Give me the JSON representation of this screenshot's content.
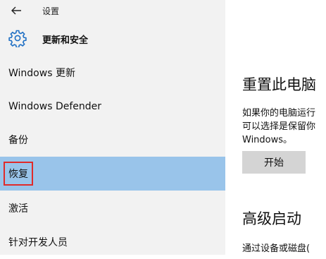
{
  "window": {
    "title": "设置"
  },
  "section": {
    "title": "更新和安全"
  },
  "nav": {
    "items": [
      {
        "label": "Windows 更新"
      },
      {
        "label": "Windows Defender"
      },
      {
        "label": "备份"
      },
      {
        "label": "恢复"
      },
      {
        "label": "激活"
      },
      {
        "label": "针对开发人员"
      }
    ],
    "selected": "恢复"
  },
  "reset": {
    "heading": "重置此电脑",
    "desc_line1": "如果你的电脑运行",
    "desc_line2": "可以选择是保留你",
    "desc_line3": "Windows。",
    "button": "开始"
  },
  "advanced": {
    "heading": "高级启动",
    "desc": "通过设备或磁盘("
  },
  "colors": {
    "sidebar_bg": "#f2f2f2",
    "selected_bg": "#99c4ea",
    "highlight_box": "#e02a2a",
    "accent": "#1e6fc4"
  },
  "icons": {
    "back": "back-arrow-icon",
    "section": "gear-icon"
  }
}
